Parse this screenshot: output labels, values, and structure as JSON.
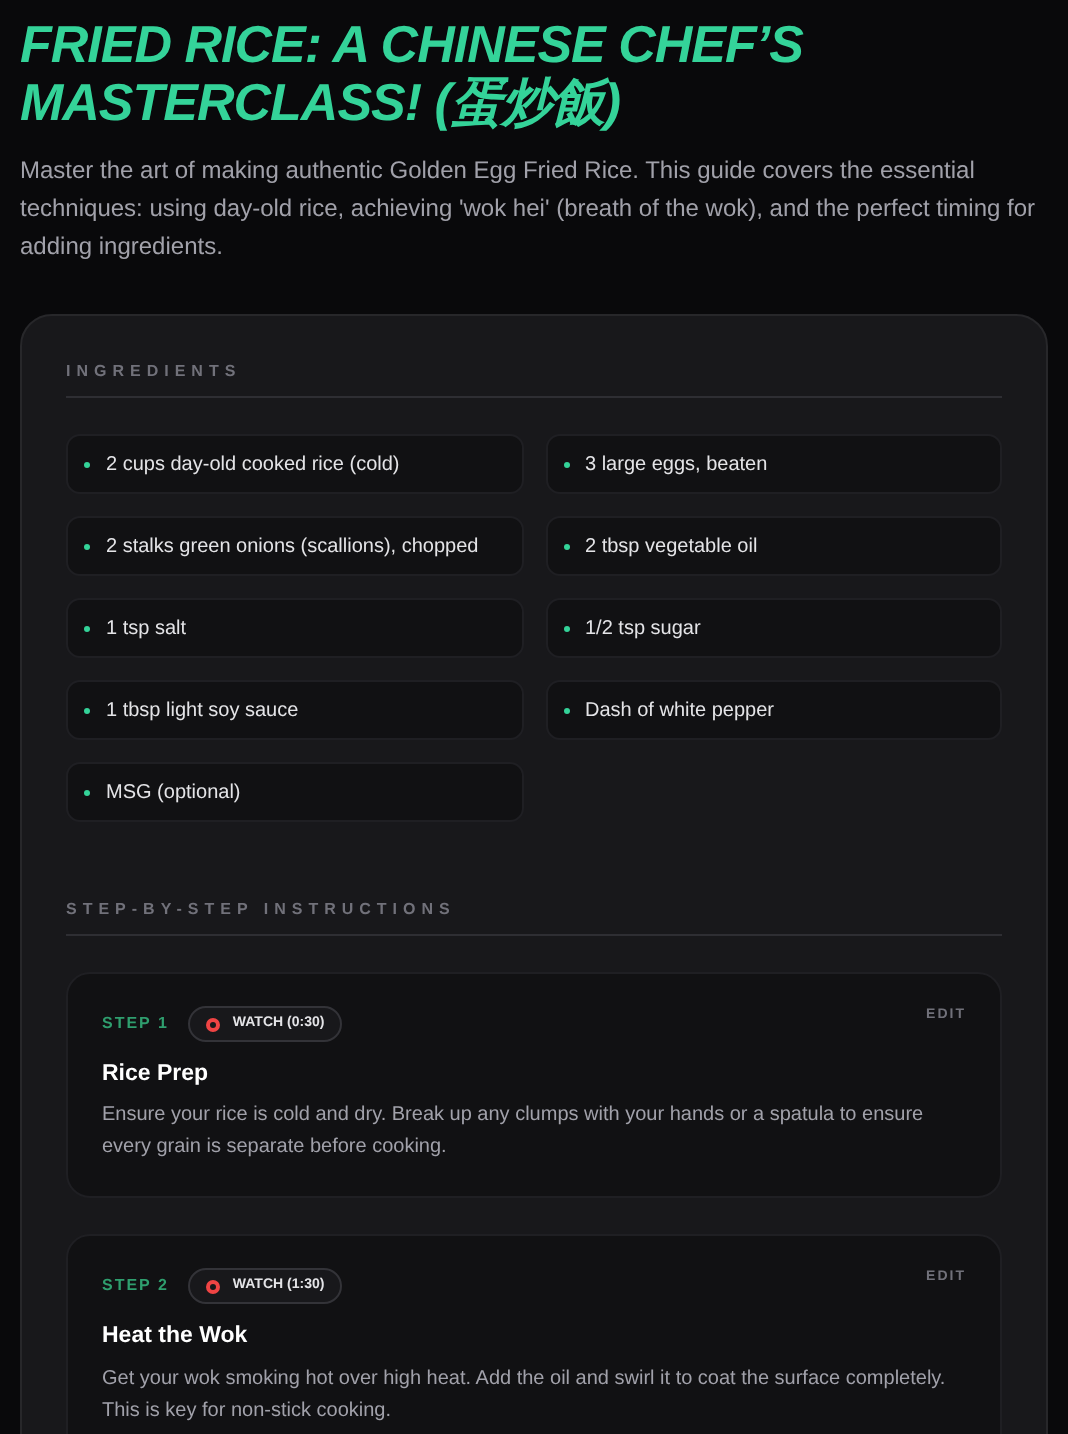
{
  "title": "FRIED RICE: A CHINESE CHEF’S MASTERCLASS! (蛋炒飯)",
  "description": "Master the art of making authentic Golden Egg Fried Rice. This guide covers the essential techniques: using day-old rice, achieving 'wok hei' (breath of the wok), and the perfect timing for adding ingredients.",
  "ingredients_heading": "INGREDIENTS",
  "ingredients": [
    "2 cups day-old cooked rice (cold)",
    "3 large eggs, beaten",
    "2 stalks green onions (scallions), chopped",
    "2 tbsp vegetable oil",
    "1 tsp salt",
    "1/2 tsp sugar",
    "1 tbsp light soy sauce",
    "Dash of white pepper",
    "MSG (optional)"
  ],
  "instructions_heading": "STEP-BY-STEP INSTRUCTIONS",
  "steps": [
    {
      "step": "STEP 1",
      "watch": "WATCH (0:30)",
      "edit": "EDIT",
      "title": "Rice Prep",
      "text": "Ensure your rice is cold and dry. Break up any clumps with your hands or a spatula to ensure every grain is separate before cooking."
    },
    {
      "step": "STEP 2",
      "watch": "WATCH (1:30)",
      "edit": "EDIT",
      "title": "Heat the Wok",
      "text": "Get your wok smoking hot over high heat. Add the oil and swirl it to coat the surface completely. This is key for non-stick cooking."
    }
  ]
}
